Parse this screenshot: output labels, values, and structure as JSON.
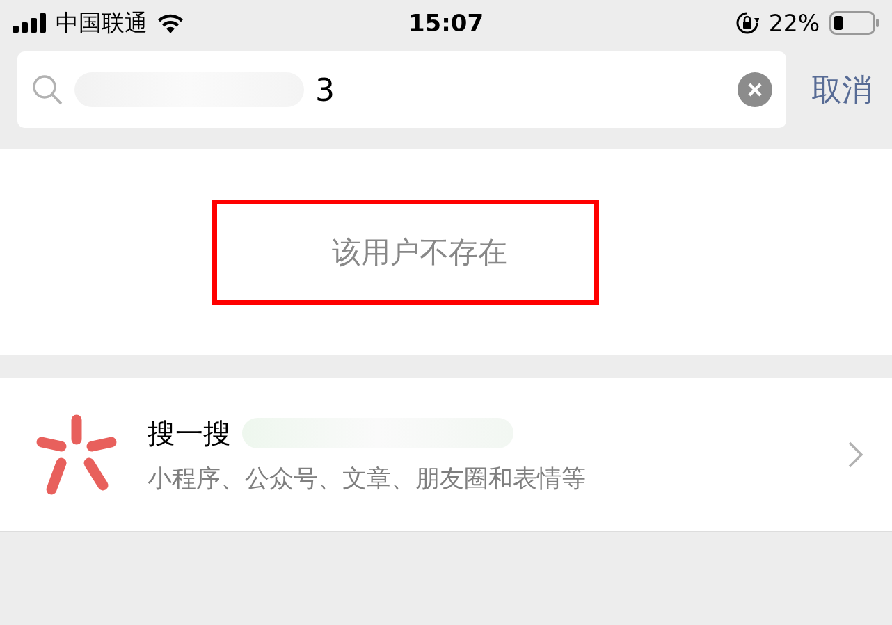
{
  "status_bar": {
    "carrier": "中国联通",
    "time": "15:07",
    "battery": "22%"
  },
  "search": {
    "value": "3",
    "cancel": "取消"
  },
  "result": {
    "message": "该用户不存在"
  },
  "search_one": {
    "title": "搜一搜",
    "subtitle": "小程序、公众号、文章、朋友圈和表情等"
  }
}
